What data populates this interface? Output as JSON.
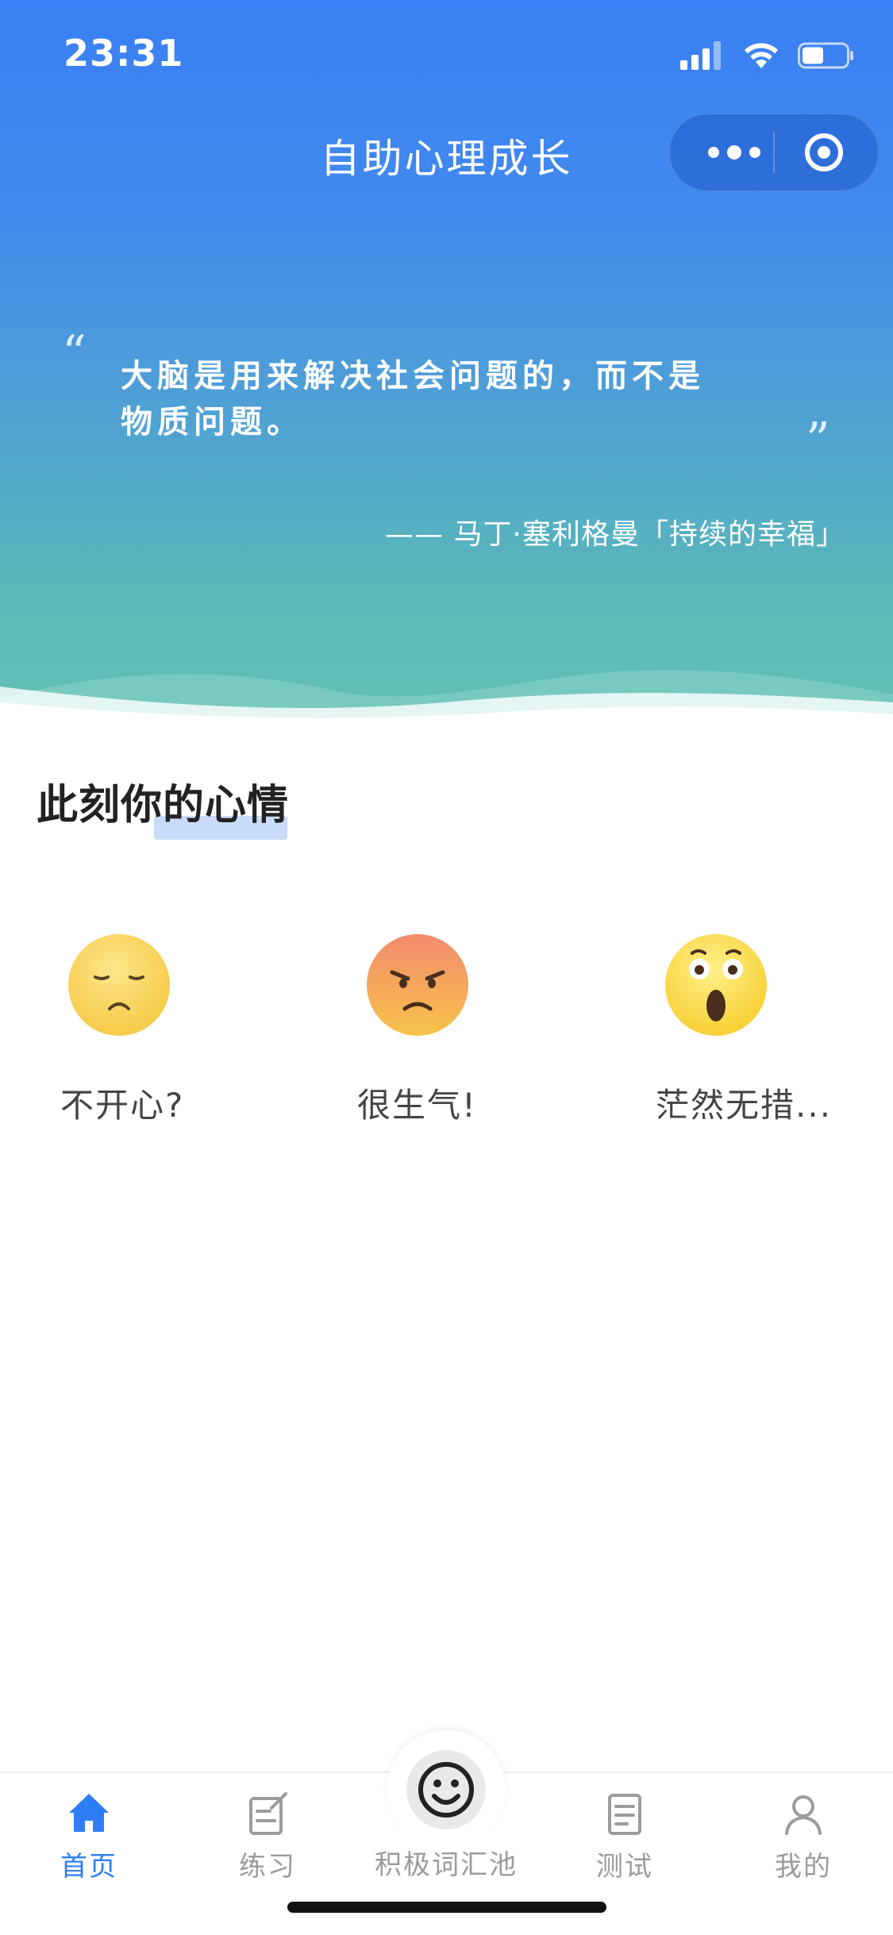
{
  "status_bar": {
    "time": "23:31"
  },
  "nav": {
    "title": "自助心理成长"
  },
  "quote": {
    "open_mark": "“",
    "line1": "大脑是用来解决社会问题的，而不是",
    "line2": "物质问题。",
    "close_mark": "”",
    "author": "—— 马丁·塞利格曼「持续的幸福」"
  },
  "section": {
    "title": "此刻你的心情"
  },
  "moods": [
    {
      "label": "不开心?",
      "icon": "sad-face-icon"
    },
    {
      "label": "很生气!",
      "icon": "angry-face-icon"
    },
    {
      "label": "茫然无措...",
      "icon": "surprised-face-icon"
    }
  ],
  "tabbar": {
    "tabs": [
      {
        "label": "首页",
        "icon": "home-icon",
        "active": true
      },
      {
        "label": "练习",
        "icon": "edit-icon",
        "active": false
      },
      {
        "label": "积极词汇池",
        "icon": "smiley-icon",
        "active": false
      },
      {
        "label": "测试",
        "icon": "test-list-icon",
        "active": false
      },
      {
        "label": "我的",
        "icon": "user-icon",
        "active": false
      }
    ]
  },
  "colors": {
    "accent": "#2f7df6",
    "hero_top": "#3a7ff3",
    "hero_bottom": "#62c0b4",
    "inactive": "#9b9b9b"
  }
}
